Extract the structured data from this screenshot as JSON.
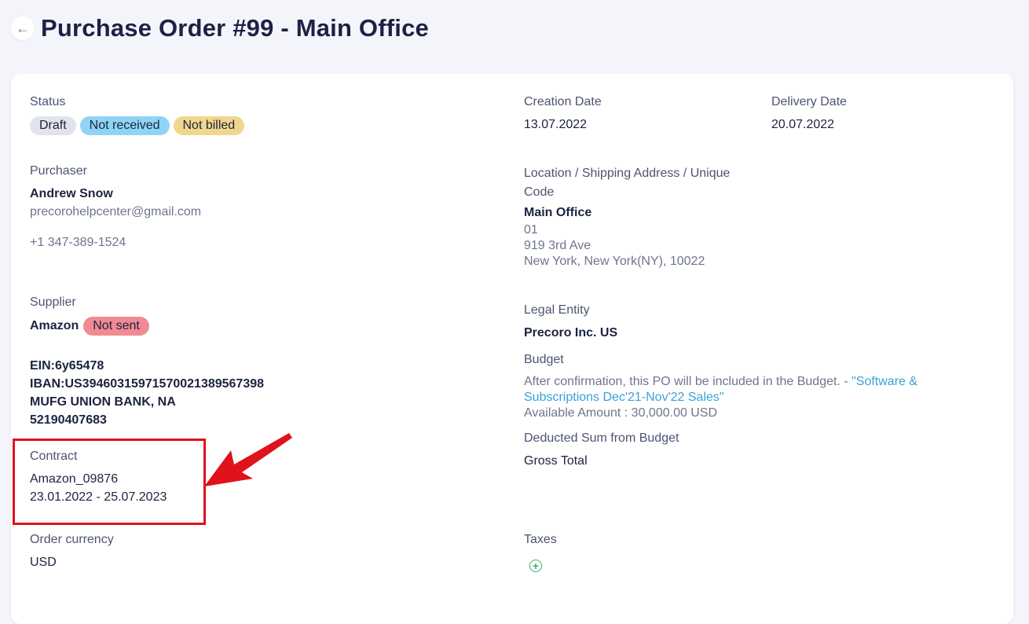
{
  "header": {
    "back_icon": "arrow-left-icon",
    "title": "Purchase Order #99 - Main Office"
  },
  "status": {
    "label": "Status",
    "badges": [
      {
        "text": "Draft",
        "color": "#e2e4ec"
      },
      {
        "text": "Not received",
        "color": "#8fd4f5"
      },
      {
        "text": "Not billed",
        "color": "#f0d78c"
      }
    ]
  },
  "creation_date": {
    "label": "Creation Date",
    "value": "13.07.2022"
  },
  "delivery_date": {
    "label": "Delivery Date",
    "value": "20.07.2022"
  },
  "purchaser": {
    "label": "Purchaser",
    "name": "Andrew Snow",
    "email": "precorohelpcenter@gmail.com",
    "phone": "+1 347-389-1524"
  },
  "location": {
    "label_line1": "Location / Shipping Address / Unique",
    "label_line2": "Code",
    "name": "Main Office",
    "code": "01",
    "street": "919 3rd Ave",
    "city": "New York, New York(NY), 10022"
  },
  "supplier": {
    "label": "Supplier",
    "name": "Amazon",
    "badge": "Not sent",
    "ein": "EIN:6y65478",
    "iban": "IBAN:US39460315971570021389567398",
    "bank": "MUFG UNION BANK, NA",
    "account": "52190407683"
  },
  "legal_entity": {
    "label": "Legal Entity",
    "value": "Precoro Inc. US"
  },
  "budget": {
    "label": "Budget",
    "text": "After confirmation, this PO will be included in the Budget. - ",
    "link_line1": "\"Software &",
    "link_line2": "Subscriptions Dec'21-Nov'22 Sales\"",
    "available": "Available Amount : 30,000.00 USD"
  },
  "deducted": {
    "label": "Deducted Sum from Budget",
    "value": "Gross Total"
  },
  "contract": {
    "label": "Contract",
    "name": "Amazon_09876",
    "period": "23.01.2022 - 25.07.2023"
  },
  "order_currency": {
    "label": "Order currency",
    "value": "USD"
  },
  "taxes": {
    "label": "Taxes",
    "add_icon": "plus-circle-icon"
  },
  "annotation": {
    "highlight_color": "#e0121c",
    "arrow_icon": "red-arrow-icon"
  }
}
